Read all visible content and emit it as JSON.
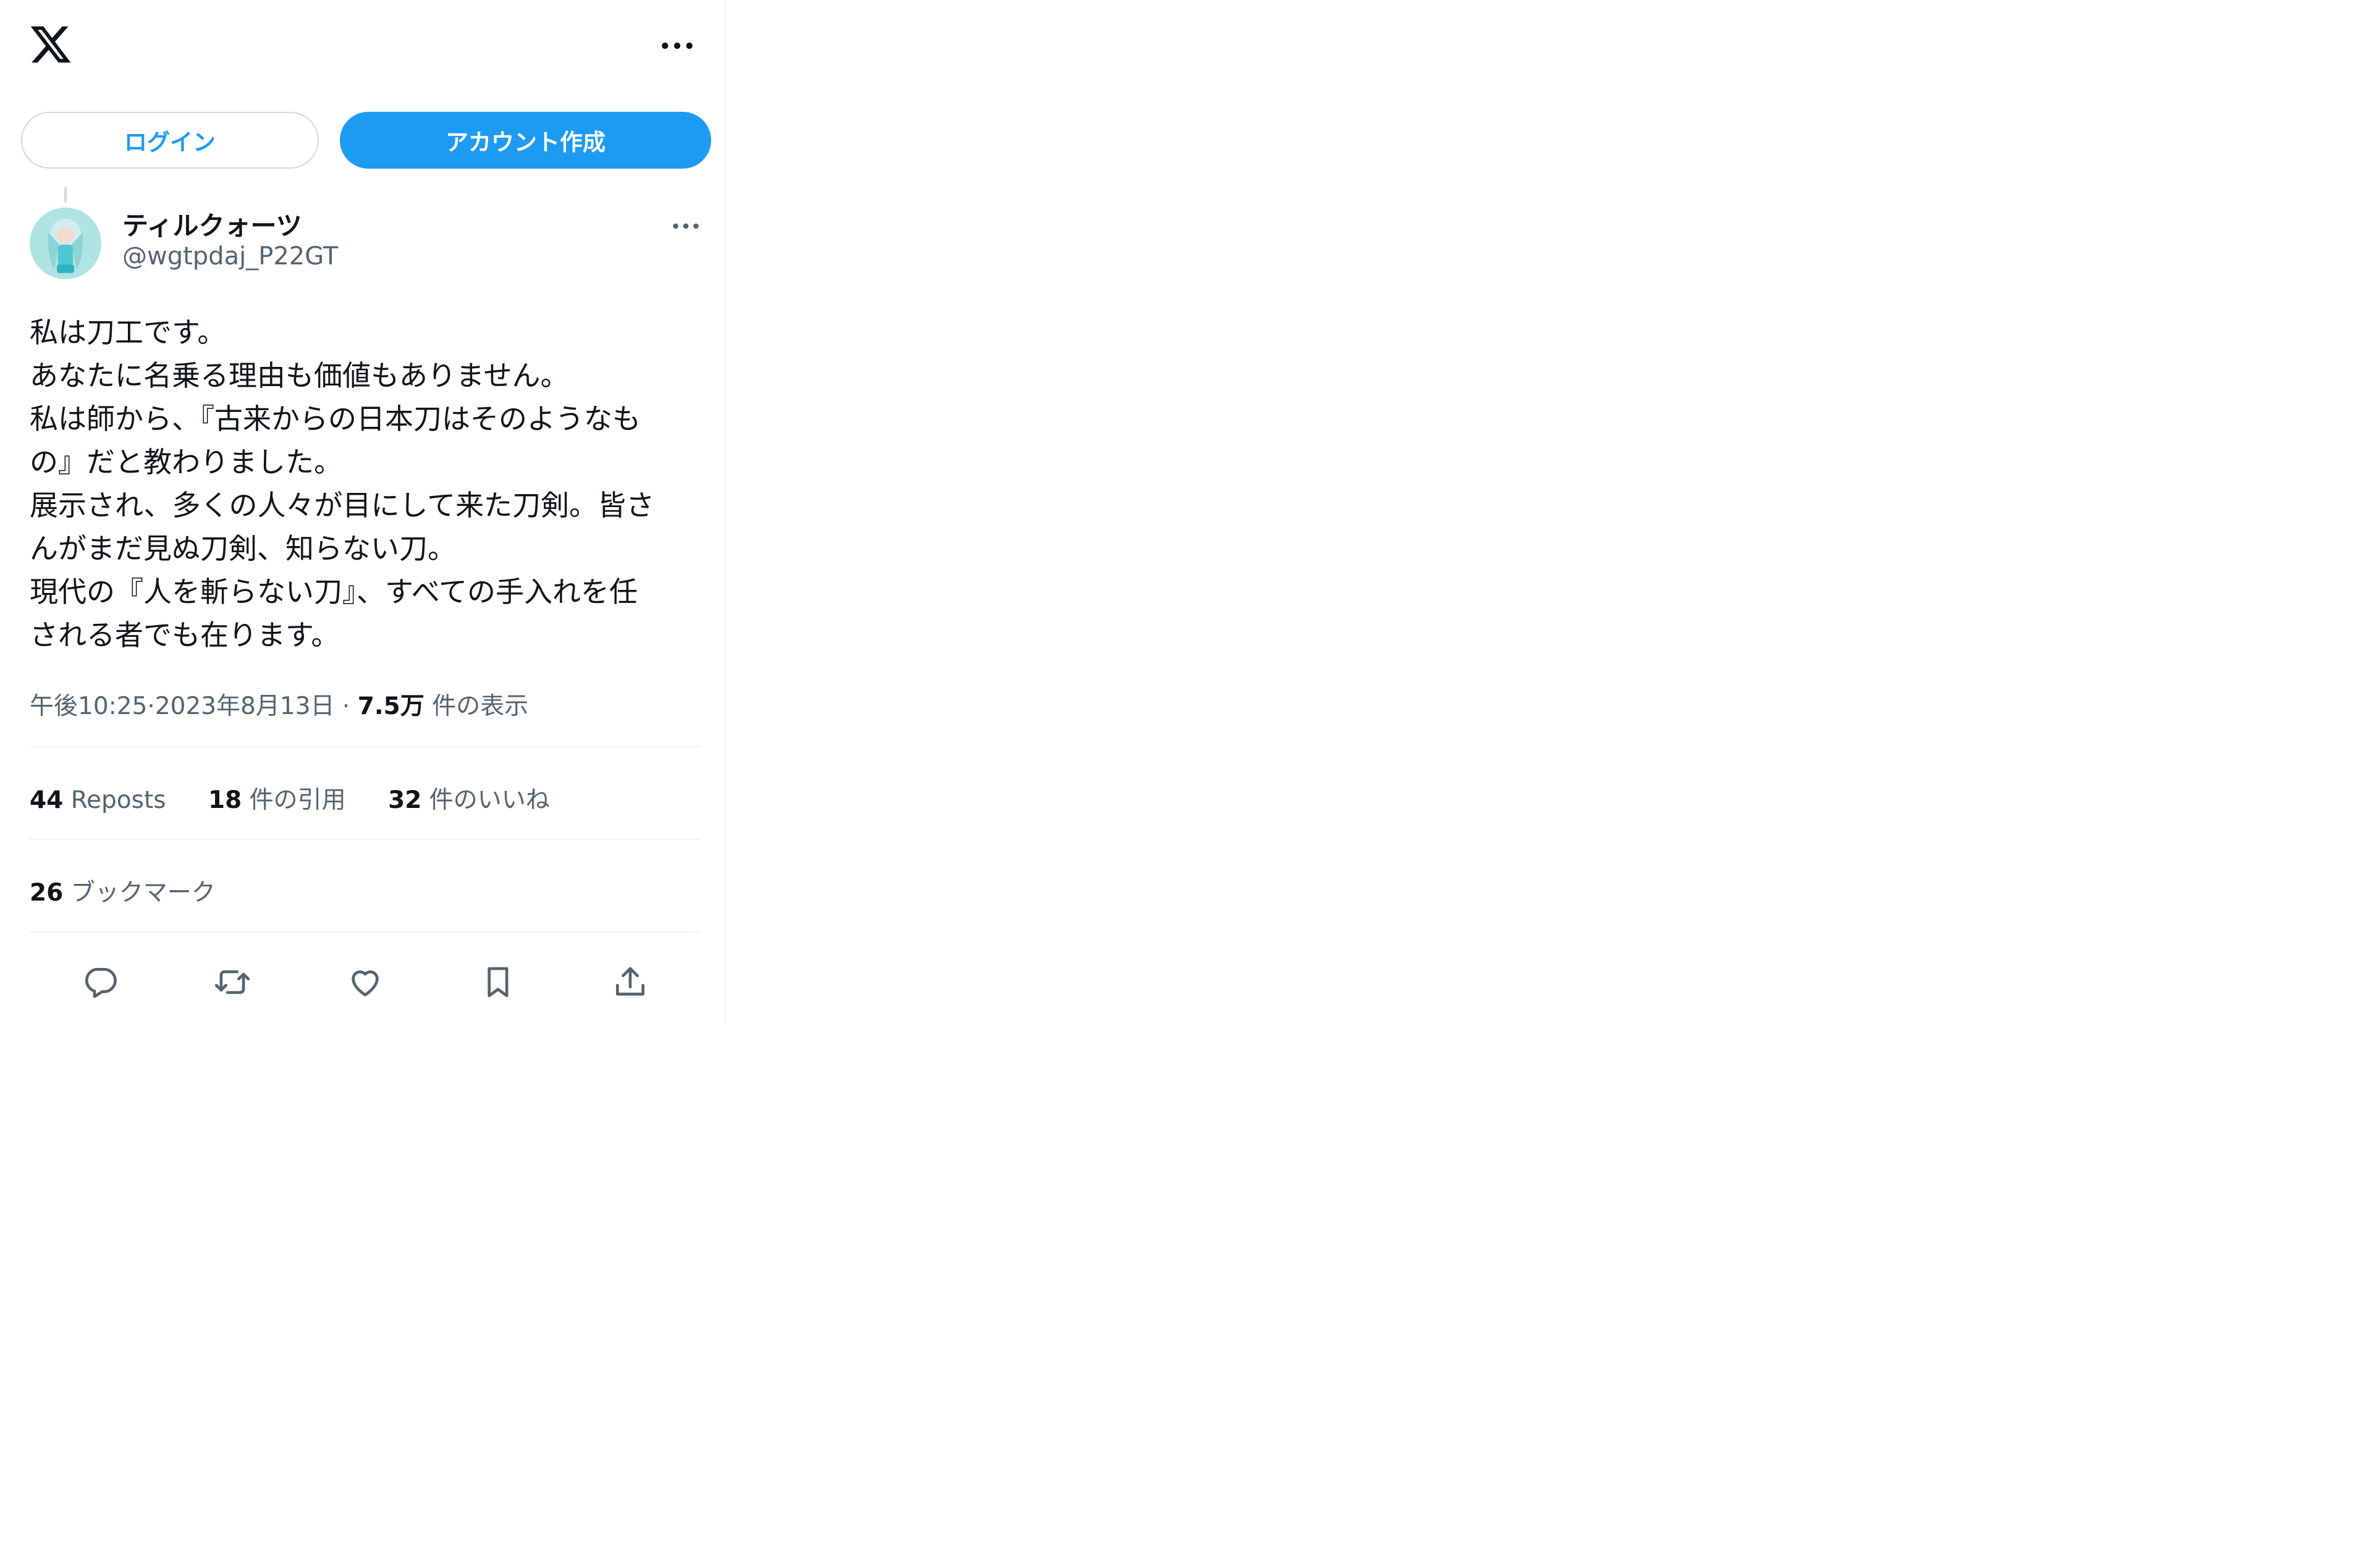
{
  "header": {
    "logo_icon": "x-logo-icon",
    "more_icon": "more-horizontal-icon"
  },
  "buttons": {
    "login": "ログイン",
    "signup": "アカウント作成"
  },
  "author": {
    "display_name": "ティルクォーツ",
    "handle": "@wgtpdaj_P22GT"
  },
  "tweet": {
    "lines": [
      "私は刀工です。",
      "あなたに名乗る理由も価値もありません。",
      "私は師から、『古来からの日本刀はそのようなも",
      "の』だと教わりました。",
      "展示され、多くの人々が目にして来た刀剣。皆さ",
      "んがまだ見ぬ刀剣、知らない刀。",
      "現代の『人を斬らない刀』、すべての手入れを任",
      "される者でも在ります。"
    ],
    "time": "午後10:25",
    "separator": "·",
    "date": "2023年8月13日",
    "views_count": "7.5万",
    "views_label": "件の表示"
  },
  "stats": {
    "reposts_count": "44",
    "reposts_label": "Reposts",
    "quotes_count": "18",
    "quotes_label": "件の引用",
    "likes_count": "32",
    "likes_label": "件のいいね",
    "bookmarks_count": "26",
    "bookmarks_label": "ブックマーク"
  },
  "actions": [
    "reply-icon",
    "repost-icon",
    "like-icon",
    "bookmark-icon",
    "share-icon"
  ],
  "colors": {
    "accent": "#1d9bf0",
    "text_primary": "#0f1419",
    "text_secondary": "#536471",
    "border": "#eff3f4"
  }
}
